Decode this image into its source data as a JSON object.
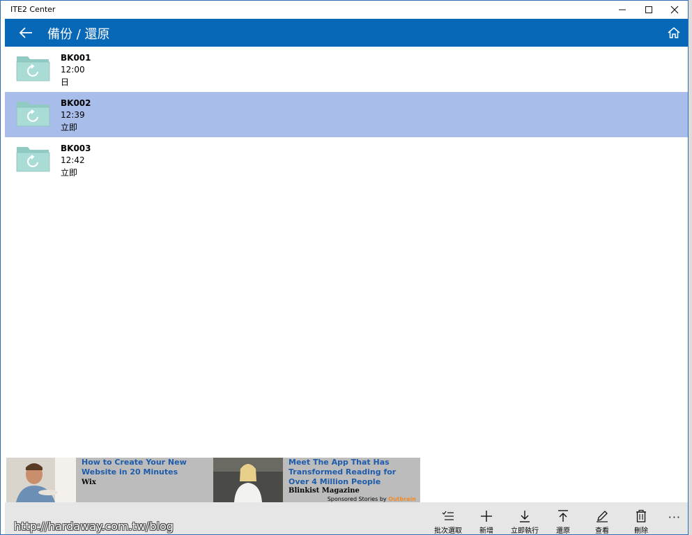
{
  "window": {
    "title": "ITE2 Center"
  },
  "appbar": {
    "title": "備份 / 還原"
  },
  "backups": [
    {
      "name": "BK001",
      "time": "12:00",
      "freq": "日",
      "selected": false
    },
    {
      "name": "BK002",
      "time": "12:39",
      "freq": "立即",
      "selected": true
    },
    {
      "name": "BK003",
      "time": "12:42",
      "freq": "立即",
      "selected": false
    }
  ],
  "ads": [
    {
      "headline": "How to Create Your New Website in 20 Minutes",
      "source": "Wix"
    },
    {
      "headline": "Meet The App That Has Transformed Reading for Over 4 Million People",
      "source": "Blinkist Magazine"
    }
  ],
  "ad_footer": {
    "prefix": "Sponsored Stories by",
    "brand": "Outbrain"
  },
  "commands": {
    "batch": "批次選取",
    "add": "新增",
    "run_now": "立即執行",
    "restore": "還原",
    "view": "查看",
    "delete": "刪除"
  },
  "watermark": "http://hardaway.com.tw/blog",
  "colors": {
    "accent": "#0868b8",
    "selected_row": "#a9bdea",
    "folder": "#a8dcd5"
  }
}
